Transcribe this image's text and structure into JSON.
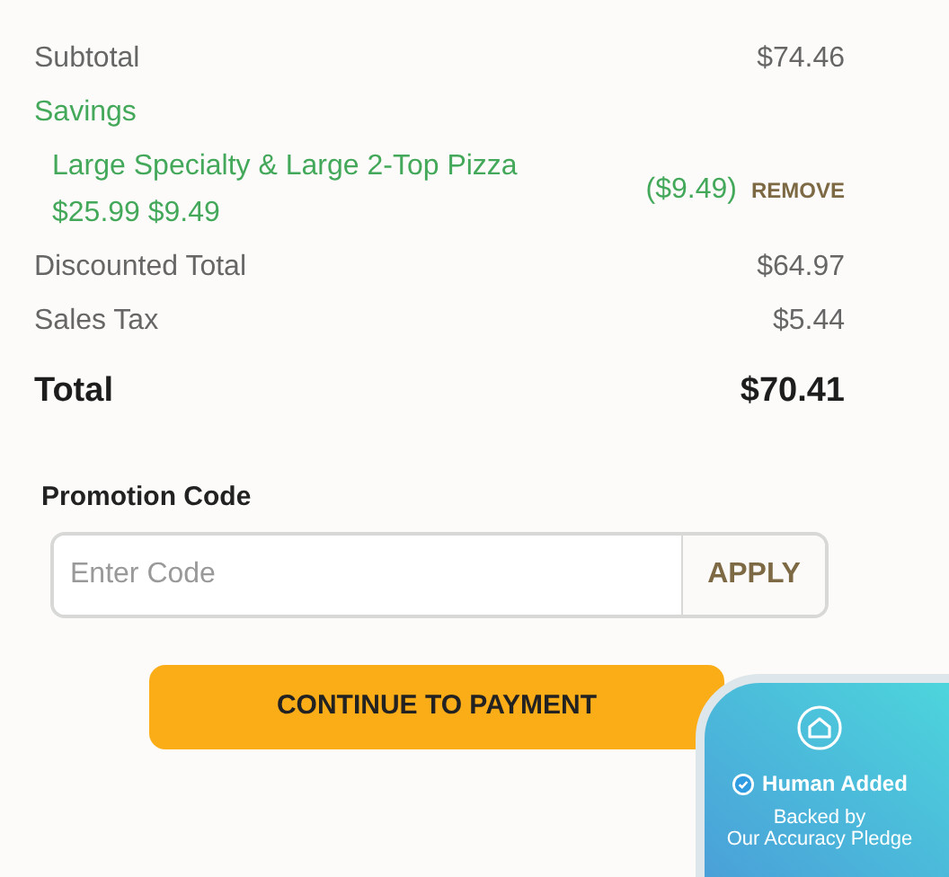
{
  "summary": [
    {
      "kind": "line",
      "label": "Subtotal",
      "amount": "$74.46"
    },
    {
      "kind": "heading",
      "label": "Savings"
    },
    {
      "kind": "discount",
      "name": "Large Specialty & Large 2-Top Pizza",
      "prices": "$25.99 $9.49",
      "amount": "($9.49)",
      "action": "REMOVE"
    },
    {
      "kind": "line",
      "label": "Discounted Total",
      "amount": "$64.97"
    },
    {
      "kind": "line",
      "label": "Sales Tax",
      "amount": "$5.44"
    },
    {
      "kind": "total",
      "label": "Total",
      "amount": "$70.41"
    }
  ],
  "promotion": {
    "label": "Promotion Code",
    "placeholder": "Enter Code",
    "button": "APPLY"
  },
  "continue_button": "CONTINUE TO PAYMENT",
  "badge": {
    "title": "Human Added",
    "subtitle": "Backed by",
    "line2": "Our Accuracy Pledge"
  }
}
